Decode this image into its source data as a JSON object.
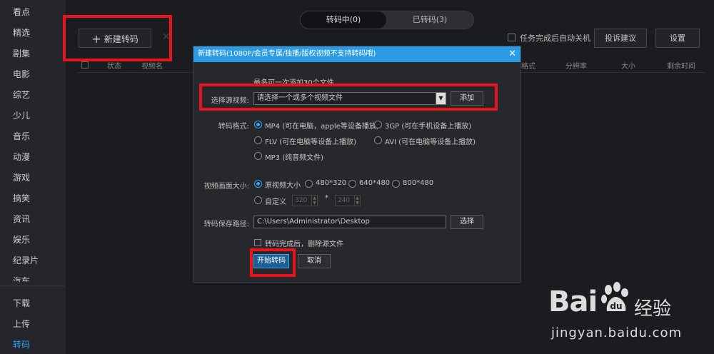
{
  "sidebar": {
    "items": [
      "看点",
      "精选",
      "剧集",
      "电影",
      "综艺",
      "少儿",
      "音乐",
      "动漫",
      "游戏",
      "搞笑",
      "资讯",
      "娱乐",
      "纪录片",
      "汽车"
    ],
    "bottom_items": [
      "下载",
      "上传",
      "转码"
    ]
  },
  "tabs": {
    "converting": "转码中(0)",
    "converted": "已转码(3)"
  },
  "toolbar": {
    "new_convert": "新建转码",
    "auto_shutdown": "任务完成后自动关机",
    "feedback": "投诉建议",
    "settings": "设置"
  },
  "table": {
    "headers": {
      "status": "状态",
      "video_name": "视频名",
      "format": "格式",
      "resolution": "分辨率",
      "size": "大小",
      "remaining": "剩余时间"
    }
  },
  "dialog": {
    "title": "新建转码(1080P/会员专属/独播/版权视频不支持转码哦)",
    "max_hint": "最多可一次添加30个文件",
    "source_label": "选择源视频:",
    "source_placeholder": "请选择一个或多个视频文件",
    "add_button": "添加",
    "format_label": "转码格式:",
    "formats": {
      "mp4": "MP4 (可在电脑，apple等设备播放)",
      "gp3": "3GP (可在手机设备上播放)",
      "flv": "FLV (可在电脑等设备上播放)",
      "avi": "AVI (可在电脑等设备上播放)",
      "mp3": "MP3 (纯音频文件)"
    },
    "size_label": "视频画面大小:",
    "sizes": {
      "original": "原视频大小",
      "s480": "480*320",
      "s640": "640*480",
      "s800": "800*480",
      "custom": "自定义"
    },
    "custom_w": "320",
    "custom_h": "240",
    "custom_sep": "*",
    "path_label": "转码保存路径:",
    "path_value": "C:\\Users\\Administrator\\Desktop",
    "choose_button": "选择",
    "delete_source": "转码完成后，删除源文件",
    "start_button": "开始转码",
    "cancel_button": "取消"
  },
  "watermark": {
    "brand": "Bai",
    "brand_cn": "经验",
    "url": "jingyan.baidu.com"
  },
  "colors": {
    "accent": "#2b9be6",
    "highlight": "#e8141b"
  }
}
